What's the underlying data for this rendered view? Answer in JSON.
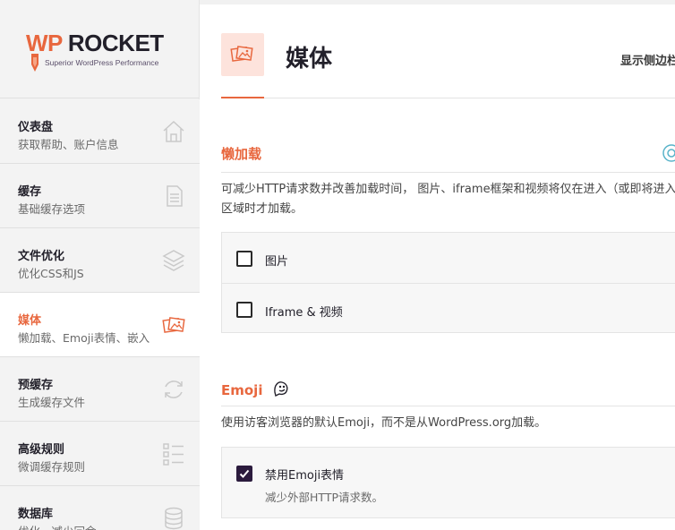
{
  "logo": {
    "wp": "WP",
    "rocket": "ROCKET",
    "tagline": "Superior WordPress Performance"
  },
  "nav": [
    {
      "title": "仪表盘",
      "desc": "获取帮助、账户信息",
      "icon": "home-icon",
      "active": false
    },
    {
      "title": "缓存",
      "desc": "基础缓存选项",
      "icon": "document-icon",
      "active": false
    },
    {
      "title": "文件优化",
      "desc": "优化CSS和JS",
      "icon": "layers-icon",
      "active": false
    },
    {
      "title": "媒体",
      "desc": "懒加载、Emoji表情、嵌入",
      "icon": "images-icon",
      "active": true
    },
    {
      "title": "预缓存",
      "desc": "生成缓存文件",
      "icon": "refresh-icon",
      "active": false
    },
    {
      "title": "高级规则",
      "desc": "微调缓存规则",
      "icon": "list-icon",
      "active": false
    },
    {
      "title": "数据库",
      "desc": "优化，减少冗余",
      "icon": "database-icon",
      "active": false
    }
  ],
  "header": {
    "title": "媒体",
    "sidebar_toggle": "显示侧边栏"
  },
  "lazyload": {
    "title": "懒加载",
    "desc_line1": "可减少HTTP请求数并改善加载时间， 图片、iframe框架和视频将仅在进入（或即将进入）",
    "desc_line2": "区域时才加载。",
    "options": [
      {
        "label": "图片",
        "checked": false
      },
      {
        "label": "Iframe & 视频",
        "checked": false
      }
    ]
  },
  "emoji": {
    "title": "Emoji",
    "desc": "使用访客浏览器的默认Emoji，而不是从WordPress.org加载。",
    "option": {
      "label": "禁用Emoji表情",
      "sub": "减少外部HTTP请求数。",
      "checked": true
    }
  },
  "colors": {
    "accent": "#e8673e",
    "dark": "#22202a",
    "checkbox_checked": "#2b1b3d"
  }
}
